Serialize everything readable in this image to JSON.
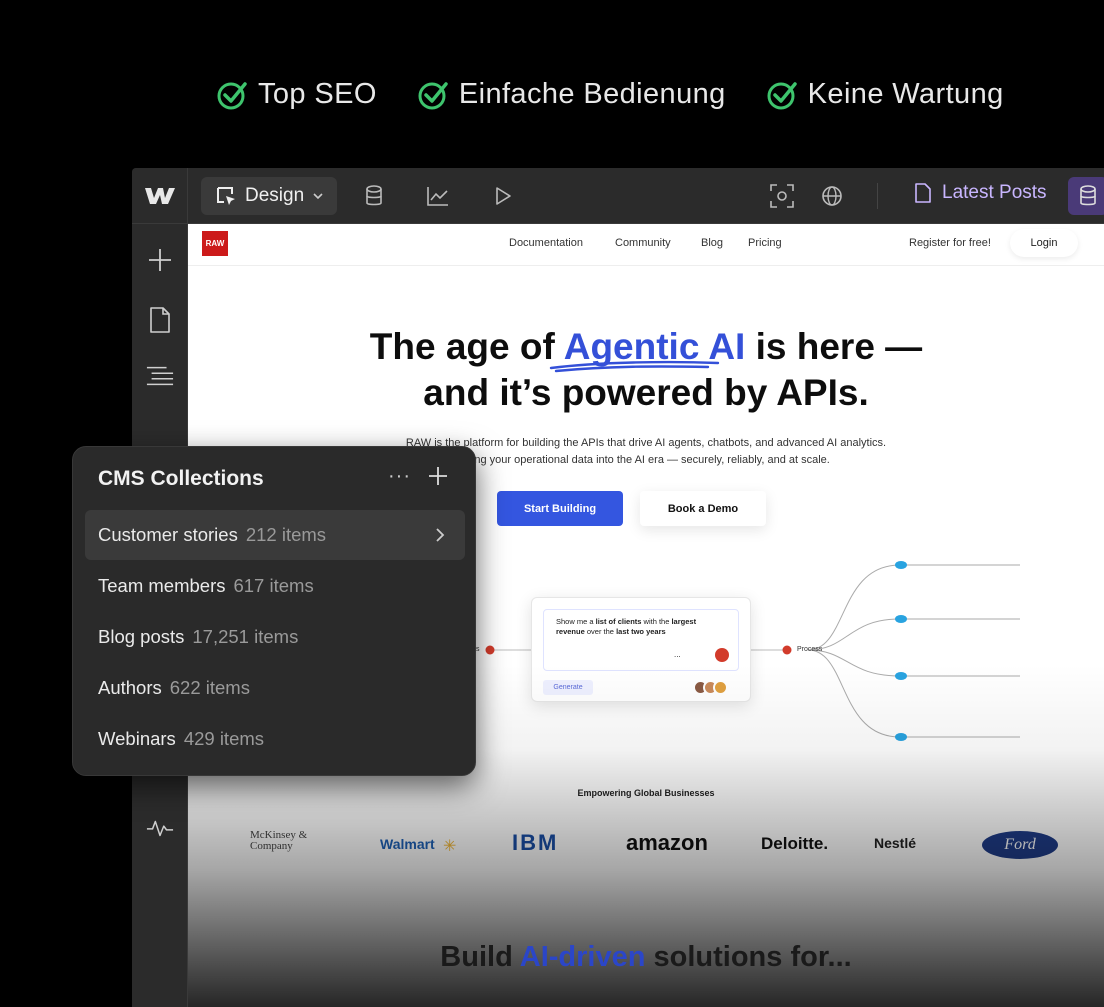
{
  "features": [
    {
      "label": "Top SEO",
      "icon": "check-circle-icon"
    },
    {
      "label": "Einfache Bedienung",
      "icon": "check-circle-icon"
    },
    {
      "label": "Keine Wartung",
      "icon": "check-circle-icon"
    }
  ],
  "colors": {
    "check": "#3ec46d",
    "accent_purple": "#c9b6ff",
    "cta_blue": "#3456e0"
  },
  "toolbar": {
    "mode_label": "Design",
    "page_label": "Latest Posts",
    "icons": [
      "webflow-logo-icon",
      "cursor-select-icon",
      "chevron-down-icon",
      "database-icon",
      "chart-icon",
      "play-icon",
      "focus-icon",
      "globe-icon",
      "page-icon",
      "database-icon"
    ]
  },
  "sidebar": {
    "icons": [
      "plus-icon",
      "page-icon",
      "navigator-icon",
      "activity-icon"
    ]
  },
  "site": {
    "logo": "RAW",
    "nav": [
      "Documentation",
      "Community",
      "Blog",
      "Pricing"
    ],
    "register": "Register for free!",
    "login": "Login",
    "hero_line1_pre": "The age of ",
    "hero_line1_accent": "Agentic AI",
    "hero_line1_post": " is here —",
    "hero_line2": "and it’s powered by APIs.",
    "sub_line1": "RAW is the platform for building the APIs that drive AI agents, chatbots, and advanced AI analytics.",
    "sub_line2": "bring your operational data into the AI era — securely, reliably, and at scale.",
    "cta_primary": "Start Building",
    "cta_secondary": "Book a Demo",
    "prompt_text_1": "Show me a ",
    "prompt_bold_1": "list of clients",
    "prompt_text_2": " with the ",
    "prompt_bold_2": "largest revenue",
    "prompt_text_3": " over the ",
    "prompt_bold_3": "last two years",
    "prompt_dots": "...",
    "generate": "Generate",
    "process_label": "Process",
    "left_label": "s",
    "empower": "Empowering Global Businesses",
    "logos": [
      "McKinsey & Company",
      "Walmart",
      "IBM",
      "amazon",
      "Deloitte.",
      "Nestlé",
      "Ford"
    ],
    "bottom_pre": "Build ",
    "bottom_accent": "AI-driven",
    "bottom_post": " solutions for..."
  },
  "cms": {
    "title": "CMS Collections",
    "more": "···",
    "collections": [
      {
        "name": "Customer stories",
        "count": "212 items",
        "active": true
      },
      {
        "name": "Team members",
        "count": "617 items",
        "active": false
      },
      {
        "name": "Blog posts",
        "count": "17,251 items",
        "active": false
      },
      {
        "name": "Authors",
        "count": "622 items",
        "active": false
      },
      {
        "name": "Webinars",
        "count": "429 items",
        "active": false
      }
    ]
  }
}
